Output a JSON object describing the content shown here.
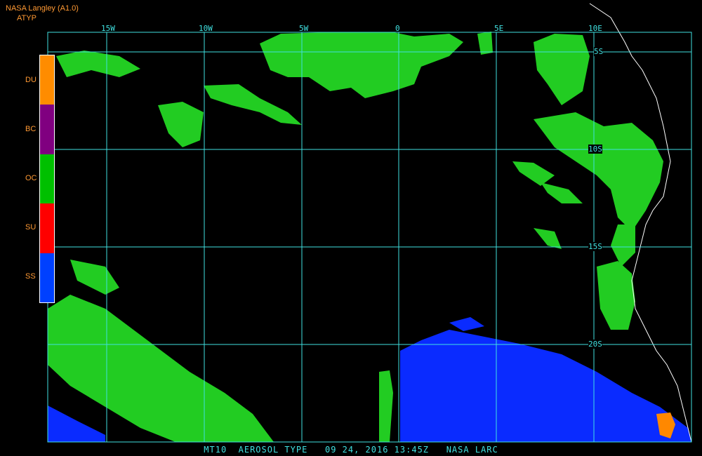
{
  "header": {
    "title": "NASA Langley (A1.0)",
    "subtitle": "ATYP"
  },
  "legend": [
    {
      "label": "DU",
      "color": "#ff8c00"
    },
    {
      "label": "BC",
      "color": "#800080"
    },
    {
      "label": "OC",
      "color": "#00c000"
    },
    {
      "label": "SU",
      "color": "#ff0000"
    },
    {
      "label": "SS",
      "color": "#0040ff"
    }
  ],
  "lon_labels": [
    "15W",
    "10W",
    "5W",
    "0",
    "5E",
    "10E"
  ],
  "lat_labels": [
    "5S",
    "10S",
    "15S",
    "20S"
  ],
  "footer": "MT10  AEROSOL TYPE   09 24, 2016 13:45Z   NASA LARC",
  "colors": {
    "grid": "#40e0e0",
    "coast": "#ffffff",
    "oc": "#22cc22",
    "ss": "#0a2bff",
    "du": "#ff8800"
  }
}
